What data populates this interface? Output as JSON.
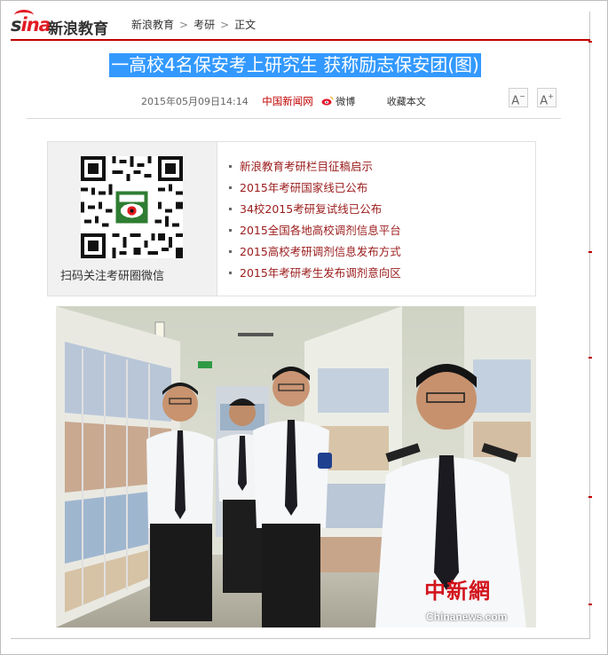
{
  "brand": {
    "logo_text_1": "s",
    "logo_text_2": "ina",
    "site_name": "新浪教育"
  },
  "breadcrumb": {
    "items": [
      "新浪教育",
      "考研",
      "正文"
    ],
    "separator": ">"
  },
  "article": {
    "title": "一高校4名保安考上研究生 获称励志保安团(图)",
    "datetime": "2015年05月09日14:14",
    "source": "中国新闻网",
    "weibo_label": "微博",
    "favorite_label": "收藏本文"
  },
  "font_controls": {
    "decrease": "A",
    "increase": "A"
  },
  "promo": {
    "qr_caption": "扫码关注考研圈微信",
    "links": [
      "新浪教育考研栏目征稿启示",
      "2015年考研国家线已公布",
      "34校2015考研复试线已公布",
      "2015全国各地高校调剂信息平台",
      "2015高校考研调剂信息发布方式",
      "2015年考研考生发布调剂意向区"
    ]
  },
  "photo": {
    "watermark_cn": "中新網",
    "watermark_en": "Chinanews.com"
  },
  "colors": {
    "accent_red": "#c00000",
    "title_highlight": "#3399ff",
    "link_red": "#9a1b1b"
  }
}
